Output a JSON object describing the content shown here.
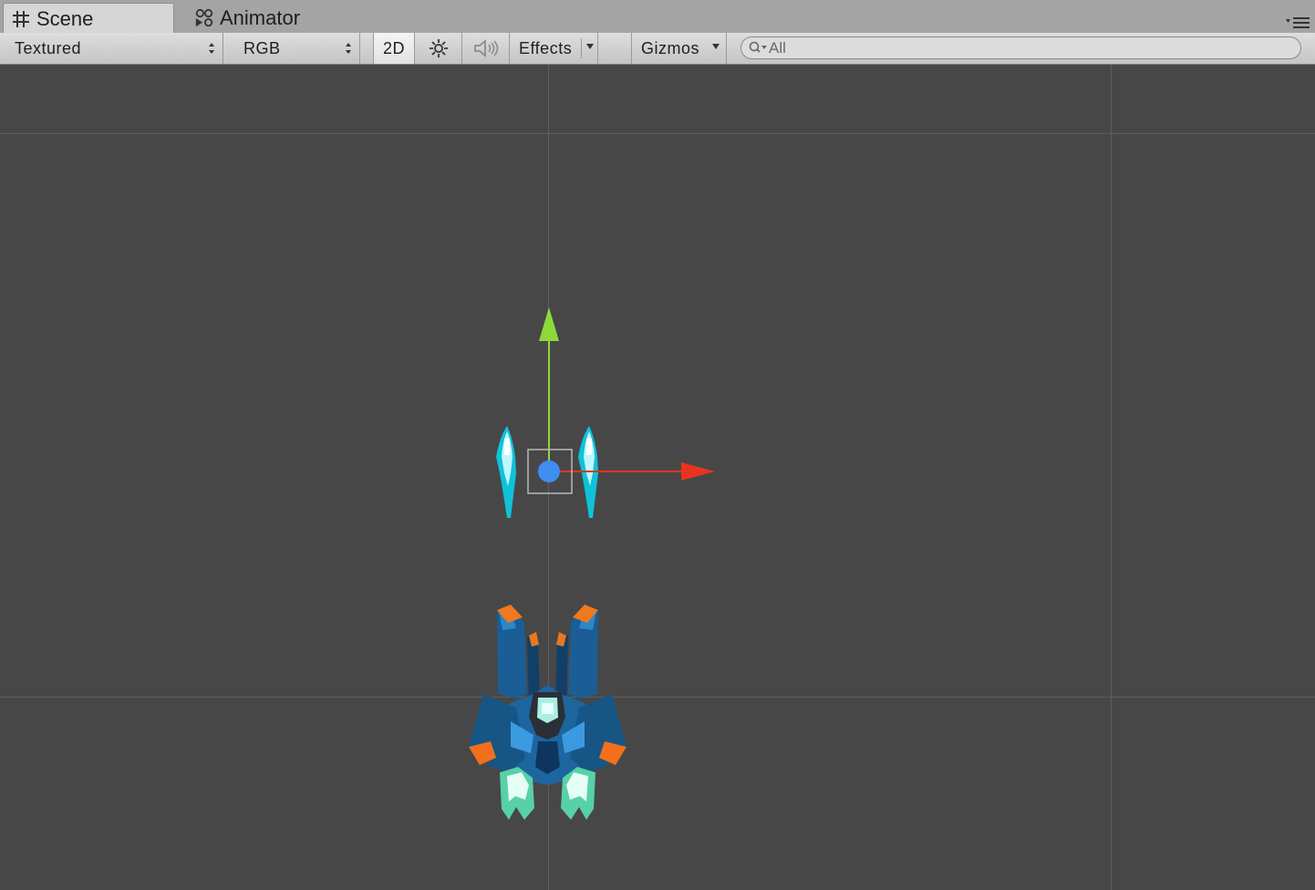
{
  "tabs": [
    {
      "label": "Scene",
      "icon": "grid-icon",
      "active": true
    },
    {
      "label": "Animator",
      "icon": "animator-icon",
      "active": false
    }
  ],
  "toolbar": {
    "draw_mode": "Textured",
    "render_mode": "RGB",
    "mode_2d_label": "2D",
    "lighting_icon": "sun-icon",
    "audio_icon": "speaker-icon",
    "effects_label": "Effects",
    "gizmos_label": "Gizmos",
    "search_placeholder": "All"
  },
  "scene": {
    "objects": [
      {
        "name": "Bullet",
        "selected": true
      },
      {
        "name": "Player Ship",
        "selected": false
      }
    ],
    "gizmo": {
      "x_axis_color": "#e8341f",
      "y_axis_color": "#8ed93a",
      "pivot_color": "#3f8ef2"
    },
    "background_color": "#474747",
    "grid_color": "#5e5e5e"
  }
}
